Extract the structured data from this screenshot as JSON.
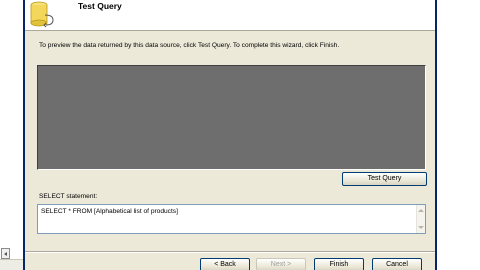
{
  "header": {
    "title": "Test Query",
    "icon": "database-icon"
  },
  "main": {
    "instructions": "To preview the data returned by this data source, click Test Query. To complete this wizard, click Finish.",
    "test_query_label": "Test Query",
    "select_label": "SELECT statement:",
    "select_text": "SELECT * FROM [Alphabetical list of products]"
  },
  "footer": {
    "back_label": "< Back",
    "next_label": "Next >",
    "finish_label": "Finish",
    "cancel_label": "Cancel"
  },
  "colors": {
    "results_background": "#6e6e6e",
    "dialog_background": "#ece9d8",
    "border_blue": "#0a246a"
  }
}
